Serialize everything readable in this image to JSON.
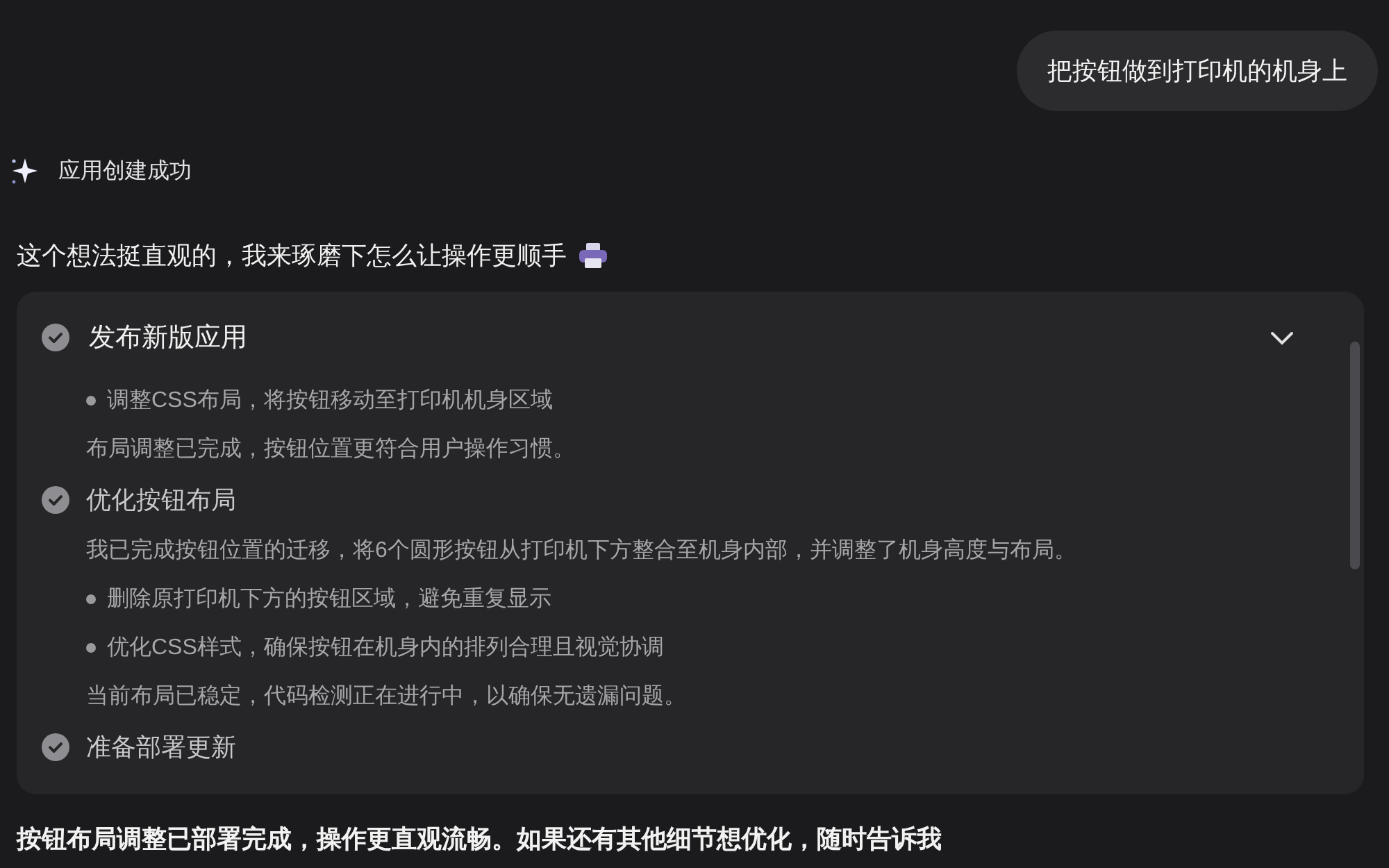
{
  "user_message": "把按钮做到打印机的机身上",
  "status": {
    "label": "应用创建成功"
  },
  "intro": "这个想法挺直观的，我来琢磨下怎么让操作更顺手",
  "task_panel": {
    "title": "发布新版应用",
    "done": true,
    "expanded": true,
    "steps": [
      {
        "kind": "bullet",
        "text": "调整CSS布局，将按钮移动至打印机机身区域"
      },
      {
        "kind": "note",
        "text": "布局调整已完成，按钮位置更符合用户操作习惯。"
      },
      {
        "kind": "step",
        "text": "优化按钮布局",
        "done": true
      },
      {
        "kind": "note",
        "text": "我已完成按钮位置的迁移，将6个圆形按钮从打印机下方整合至机身内部，并调整了机身高度与布局。"
      },
      {
        "kind": "bullet",
        "text": "删除原打印机下方的按钮区域，避免重复显示"
      },
      {
        "kind": "bullet",
        "text": "优化CSS样式，确保按钮在机身内的排列合理且视觉协调"
      },
      {
        "kind": "note",
        "text": "当前布局已稳定，代码检测正在进行中，以确保无遗漏问题。"
      },
      {
        "kind": "step",
        "text": "准备部署更新",
        "done": true
      }
    ]
  },
  "summary": "按钮布局调整已部署完成，操作更直观流畅。如果还有其他细节想优化，随时告诉我"
}
